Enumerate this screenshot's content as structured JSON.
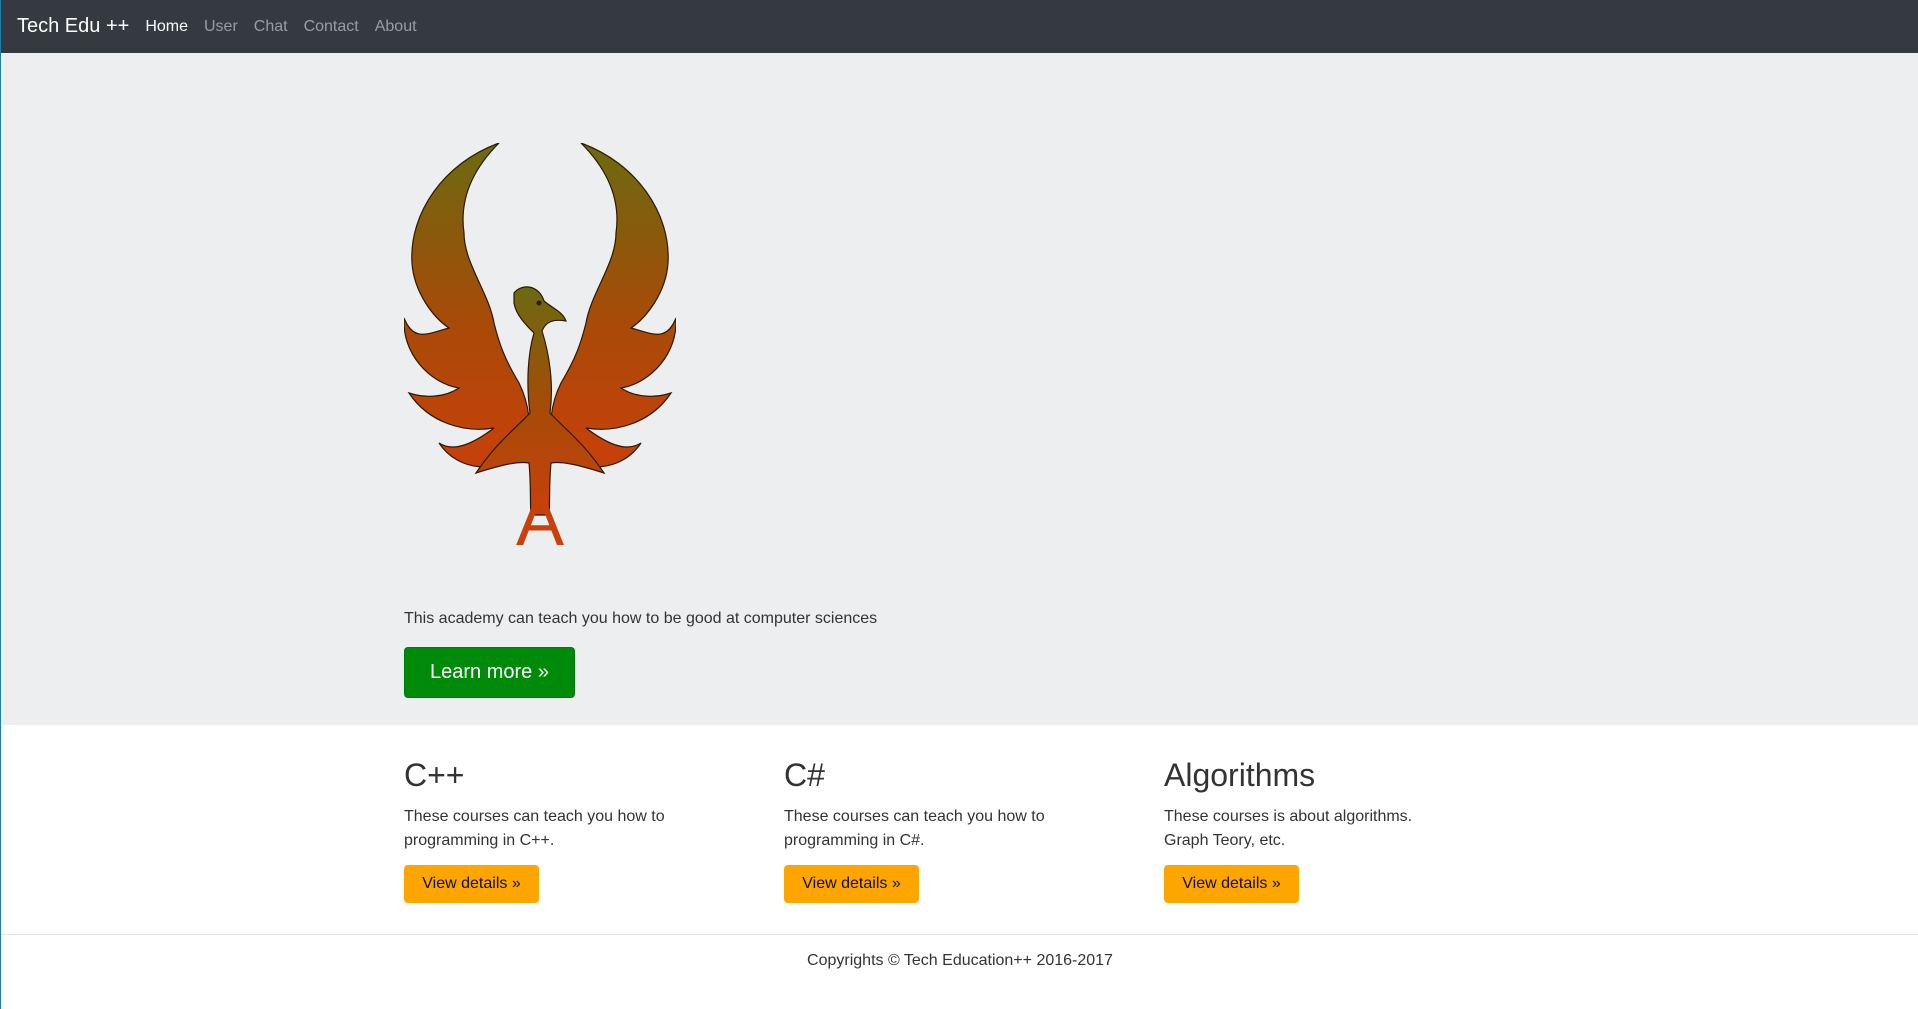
{
  "navbar": {
    "brand": "Tech Edu ++",
    "links": [
      {
        "label": "Home",
        "active": true
      },
      {
        "label": "User"
      },
      {
        "label": "Chat"
      },
      {
        "label": "Contact"
      },
      {
        "label": "About"
      }
    ]
  },
  "hero": {
    "logo_icon": "phoenix-logo-icon",
    "logo_letter": "A",
    "tagline": "This academy can teach you how to be good at computer sciences",
    "button_label": "Learn more »",
    "button_color": "#008a0a"
  },
  "courses": [
    {
      "title": "C++",
      "description": "These courses can teach you how to programming in C++.",
      "button_label": "View details »"
    },
    {
      "title": "C#",
      "description": "These courses can teach you how to programming in C#.",
      "button_label": "View details »"
    },
    {
      "title": "Algorithms",
      "description": "These courses is about algorithms. Graph Teory, etc.",
      "button_label": "View details »"
    }
  ],
  "footer": {
    "text": "Copyrights © Tech Education++ 2016-2017"
  },
  "colors": {
    "navbar_bg": "#343a40",
    "hero_bg": "#eceef0",
    "detail_button": "#ffa500",
    "logo_gradient_top": "#6b6a10",
    "logo_gradient_bottom": "#c8400a"
  }
}
